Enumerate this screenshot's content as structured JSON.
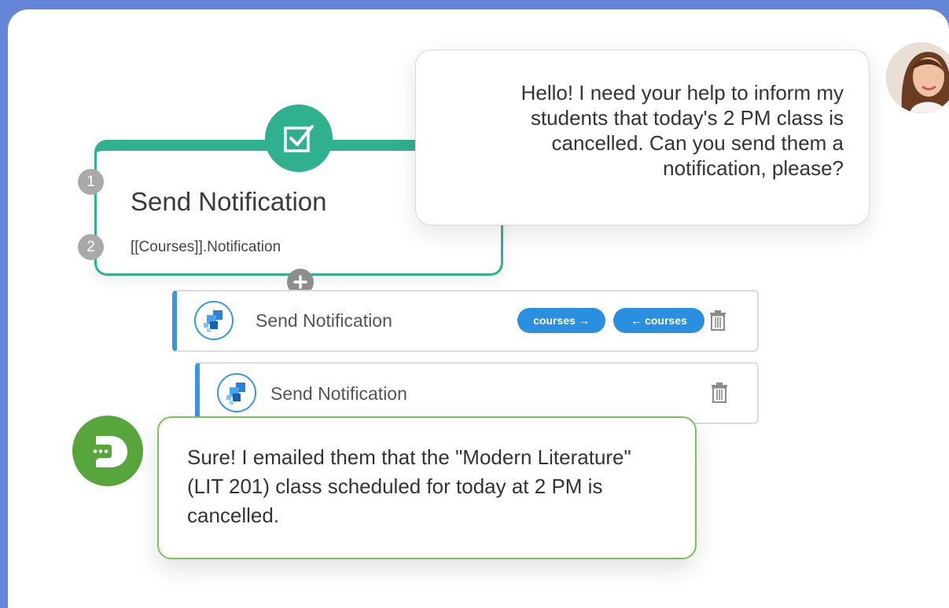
{
  "user_message": "Hello! I need your help to inform my students that today's 2 PM class is cancelled. Can you send them a notification, please?",
  "node": {
    "title": "Send Notification",
    "subtitle": "[[Courses]].Notification",
    "steps": [
      "1",
      "2"
    ],
    "icon": "checkbox-icon",
    "add_icon": "plus-icon",
    "accent_color": "#2fb08f"
  },
  "actions": [
    {
      "label": "Send Notification",
      "tags": [
        "courses →",
        "← courses"
      ],
      "icon": "app-logo-icon"
    },
    {
      "label": "Send Notification",
      "tags": [],
      "icon": "app-logo-icon"
    }
  ],
  "bot_message": "Sure! I emailed them that the \"Modern Literature\" (LIT 201) class scheduled for today at 2 PM is cancelled.",
  "colors": {
    "background": "#6585d8",
    "action_accent": "#3b95e5",
    "tag": "#2b8fe0",
    "bot": "#56a63c"
  }
}
